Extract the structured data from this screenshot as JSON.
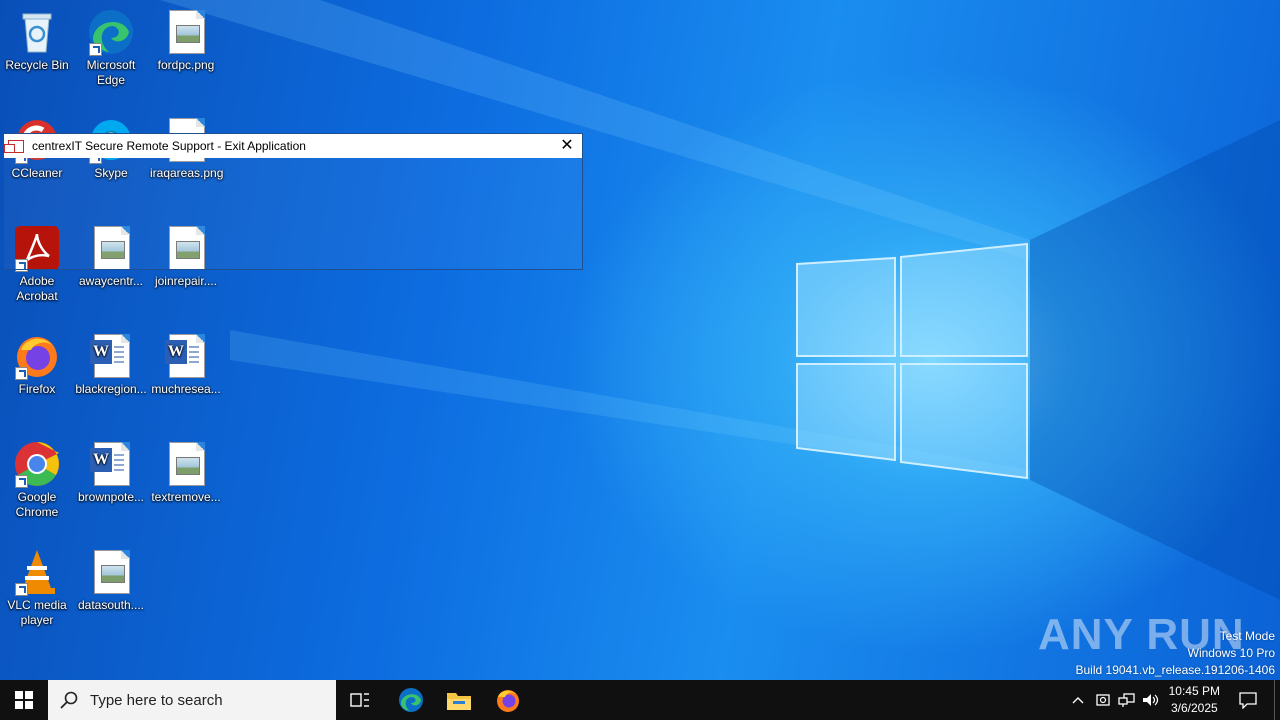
{
  "desktop": {
    "icons": [
      {
        "label": "Recycle Bin"
      },
      {
        "label": "Microsoft Edge"
      },
      {
        "label": "fordpc.png"
      },
      {
        "label": "CCleaner"
      },
      {
        "label": "Skype"
      },
      {
        "label": "iraqareas.png"
      },
      {
        "label": "Adobe Acrobat"
      },
      {
        "label": "awaycentr..."
      },
      {
        "label": "joinrepair...."
      },
      {
        "label": "Firefox"
      },
      {
        "label": "blackregion..."
      },
      {
        "label": "muchresea..."
      },
      {
        "label": "Google Chrome"
      },
      {
        "label": "brownpote..."
      },
      {
        "label": "textremove..."
      },
      {
        "label": "VLC media player"
      },
      {
        "label": "datasouth...."
      }
    ],
    "watermark": {
      "line1": "Test Mode",
      "line2": "Windows 10 Pro",
      "line3": "Build 19041.vb_release.191206-1406"
    },
    "brand_overlay": "ANY RUN"
  },
  "dialog": {
    "title": "centrexIT Secure Remote Support - Exit Application",
    "close_glyph": "✕"
  },
  "taskbar": {
    "search_placeholder": "Type here to search",
    "time": "10:45 PM",
    "date": "3/6/2025"
  },
  "colors": {
    "taskbar_bg": "#101010",
    "desktop_accent": "#0d6de0",
    "dialog_border": "#1f4f8f"
  }
}
